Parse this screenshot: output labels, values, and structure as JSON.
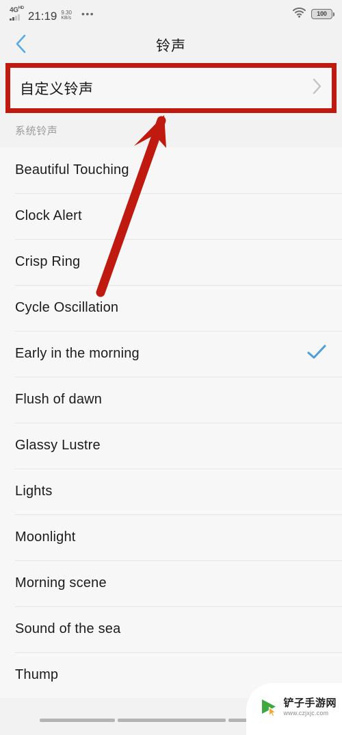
{
  "status_bar": {
    "network_label": "4G",
    "network_sup": "HD",
    "time": "21:19",
    "speed_value": "9.30",
    "speed_unit": "KB/s",
    "overflow_dots": "•••",
    "wifi_icon": "wifi-icon",
    "battery_level": "100"
  },
  "header": {
    "back_icon": "chevron-left-icon",
    "title": "铃声"
  },
  "custom_ringtone": {
    "label": "自定义铃声",
    "chevron_icon": "chevron-right-icon",
    "highlight_color": "#c0190f"
  },
  "section": {
    "title": "系统铃声"
  },
  "ringtones": [
    {
      "name": "Beautiful Touching",
      "selected": false
    },
    {
      "name": "Clock Alert",
      "selected": false
    },
    {
      "name": "Crisp Ring",
      "selected": false
    },
    {
      "name": "Cycle Oscillation",
      "selected": false
    },
    {
      "name": "Early in the morning",
      "selected": true
    },
    {
      "name": "Flush of dawn",
      "selected": false
    },
    {
      "name": "Glassy Lustre",
      "selected": false
    },
    {
      "name": "Lights",
      "selected": false
    },
    {
      "name": "Moonlight",
      "selected": false
    },
    {
      "name": "Morning scene",
      "selected": false
    },
    {
      "name": "Sound of the sea",
      "selected": false
    },
    {
      "name": "Thump",
      "selected": false
    }
  ],
  "selection": {
    "check_icon": "check-icon",
    "check_color": "#4d9fdc"
  },
  "annotation": {
    "arrow_icon": "arrow-up-right-icon",
    "arrow_color": "#c0190f"
  },
  "watermark": {
    "brand": "铲子手游网",
    "url": "www.czjxjc.com",
    "logo_icon": "play-cursor-icon"
  }
}
